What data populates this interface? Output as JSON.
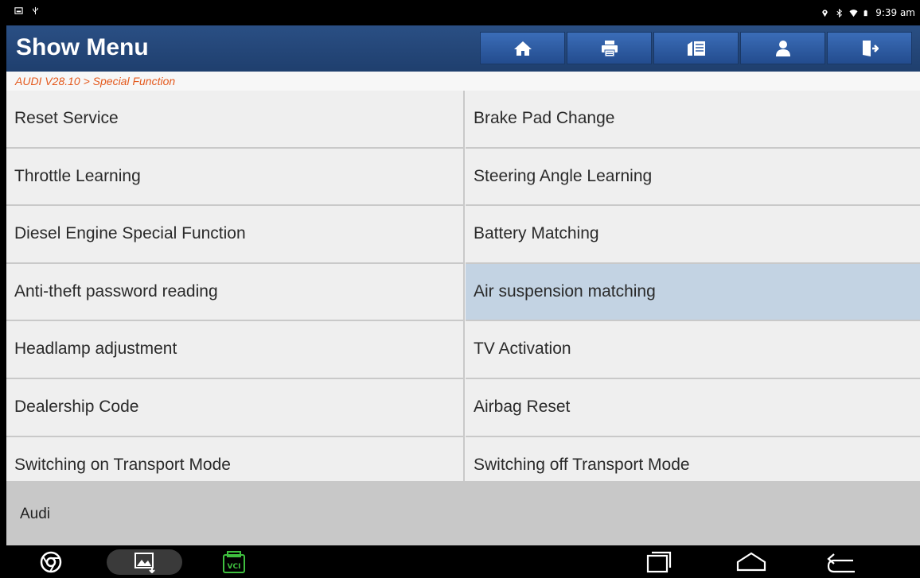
{
  "status_bar": {
    "time": "9:39 am",
    "left_icons": [
      "picture-icon",
      "usb-icon"
    ],
    "right_icons": [
      "location-icon",
      "bluetooth-icon",
      "wifi-icon",
      "battery-icon"
    ]
  },
  "header": {
    "title": "Show Menu",
    "toolbar": [
      "home-icon",
      "print-icon",
      "report-icon",
      "user-icon",
      "exit-icon"
    ]
  },
  "breadcrumb": "AUDI V28.10 > Special Function",
  "menu": {
    "selected_index": 7,
    "items": [
      "Reset Service",
      "Brake Pad Change",
      "Throttle Learning",
      "Steering Angle Learning",
      "Diesel Engine Special Function",
      "Battery Matching",
      "Anti-theft password reading",
      "Air suspension matching",
      "Headlamp adjustment",
      "TV Activation",
      "Dealership Code",
      "Airbag Reset",
      "Switching on Transport Mode",
      "Switching off Transport Mode"
    ]
  },
  "footer": {
    "label": "Audi"
  },
  "nav_bar": {
    "left_icons": [
      "chrome-icon",
      "gallery-icon",
      "vci-icon"
    ],
    "vci_label": "VCI",
    "right_icons": [
      "recent-apps-icon",
      "home-nav-icon",
      "back-icon"
    ]
  },
  "colors": {
    "header": "#1f3f6e",
    "toolbar_button": "#2f5ea6",
    "breadcrumb_text": "#e45a1e",
    "selected_row": "#c3d3e3",
    "footer": "#c8c8c8"
  }
}
